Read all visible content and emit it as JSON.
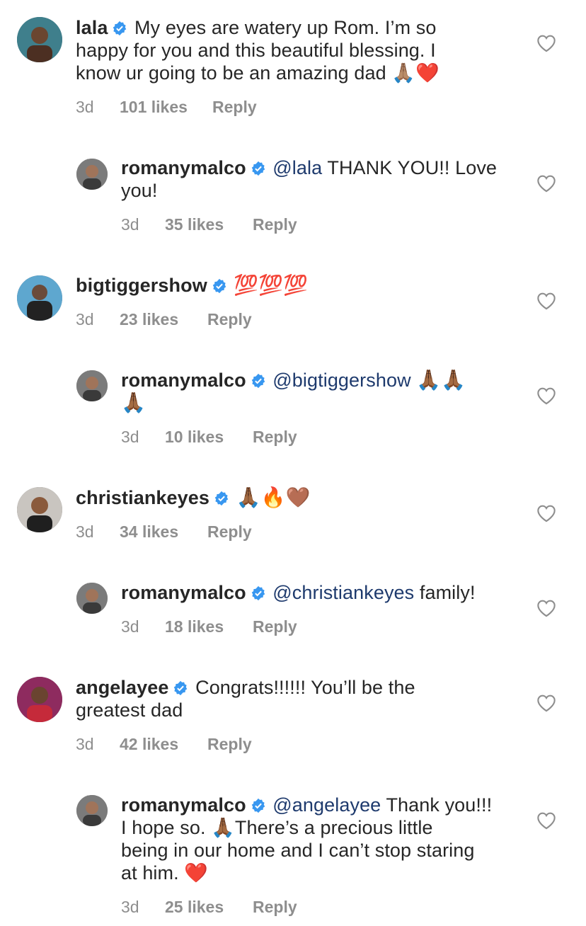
{
  "comments": [
    {
      "username": "lala",
      "text": "My eyes are watery up Rom. I’m so happy for you and this beautiful blessing. I know ur going to be an amazing dad 🙏🏽❤️",
      "text_lines": [
        "My eyes are watery up Rom. I’m so",
        "happy for you and this beautiful blessing. I",
        "know ur going to be an amazing dad 🙏🏽❤️"
      ],
      "time": "3d",
      "likes": "101 likes",
      "reply": "Reply",
      "avatar": "lala-avatar"
    },
    {
      "username": "romanymalco",
      "mention": "@lala",
      "text": "THANK YOU!! Love you!",
      "line1_rest": "THANK YOU!! Love",
      "line2": "you!",
      "time": "3d",
      "likes": "35 likes",
      "reply": "Reply",
      "avatar": "romanymalco-avatar"
    },
    {
      "username": "bigtiggershow",
      "text": "💯💯💯",
      "time": "3d",
      "likes": "23 likes",
      "reply": "Reply",
      "avatar": "bigtiggershow-avatar"
    },
    {
      "username": "romanymalco",
      "mention": "@bigtiggershow",
      "text": "🙏🏾🙏🏾🙏🏾",
      "line1_emoji": "🙏🏾🙏🏾",
      "line2_emoji": "🙏🏾",
      "time": "3d",
      "likes": "10 likes",
      "reply": "Reply",
      "avatar": "romanymalco-avatar"
    },
    {
      "username": "christiankeyes",
      "text": "🙏🏾🔥🤎",
      "time": "3d",
      "likes": "34 likes",
      "reply": "Reply",
      "avatar": "christiankeyes-avatar"
    },
    {
      "username": "romanymalco",
      "mention": "@christiankeyes",
      "text": "family!",
      "time": "3d",
      "likes": "18 likes",
      "reply": "Reply",
      "avatar": "romanymalco-avatar"
    },
    {
      "username": "angelayee",
      "text": "Congrats!!!!!! You’ll be the greatest dad",
      "line1_rest": "Congrats!!!!!! You’ll be the",
      "line2": "greatest dad",
      "time": "3d",
      "likes": "42 likes",
      "reply": "Reply",
      "avatar": "angelayee-avatar"
    },
    {
      "username": "romanymalco",
      "mention": "@angelayee",
      "text": "Thank you!!! I hope so. 🙏🏾There’s a precious little being in our home and I can’t stop staring at him. ❤️",
      "line1_rest": "Thank you!!!",
      "line2": "I hope so. 🙏🏾There’s a precious little",
      "line3": "being in our home and I can’t stop staring",
      "line4": "at him. ❤️",
      "time": "3d",
      "likes": "25 likes",
      "reply": "Reply",
      "avatar": "romanymalco-avatar"
    }
  ],
  "colors": {
    "text": "#262626",
    "meta": "#8e8e8e",
    "mention": "#1e3a6d",
    "verified": "#3897f0",
    "heart": "#8e8e8e"
  },
  "icons": {
    "verified": "verified-badge-icon",
    "like": "heart-outline-icon"
  }
}
